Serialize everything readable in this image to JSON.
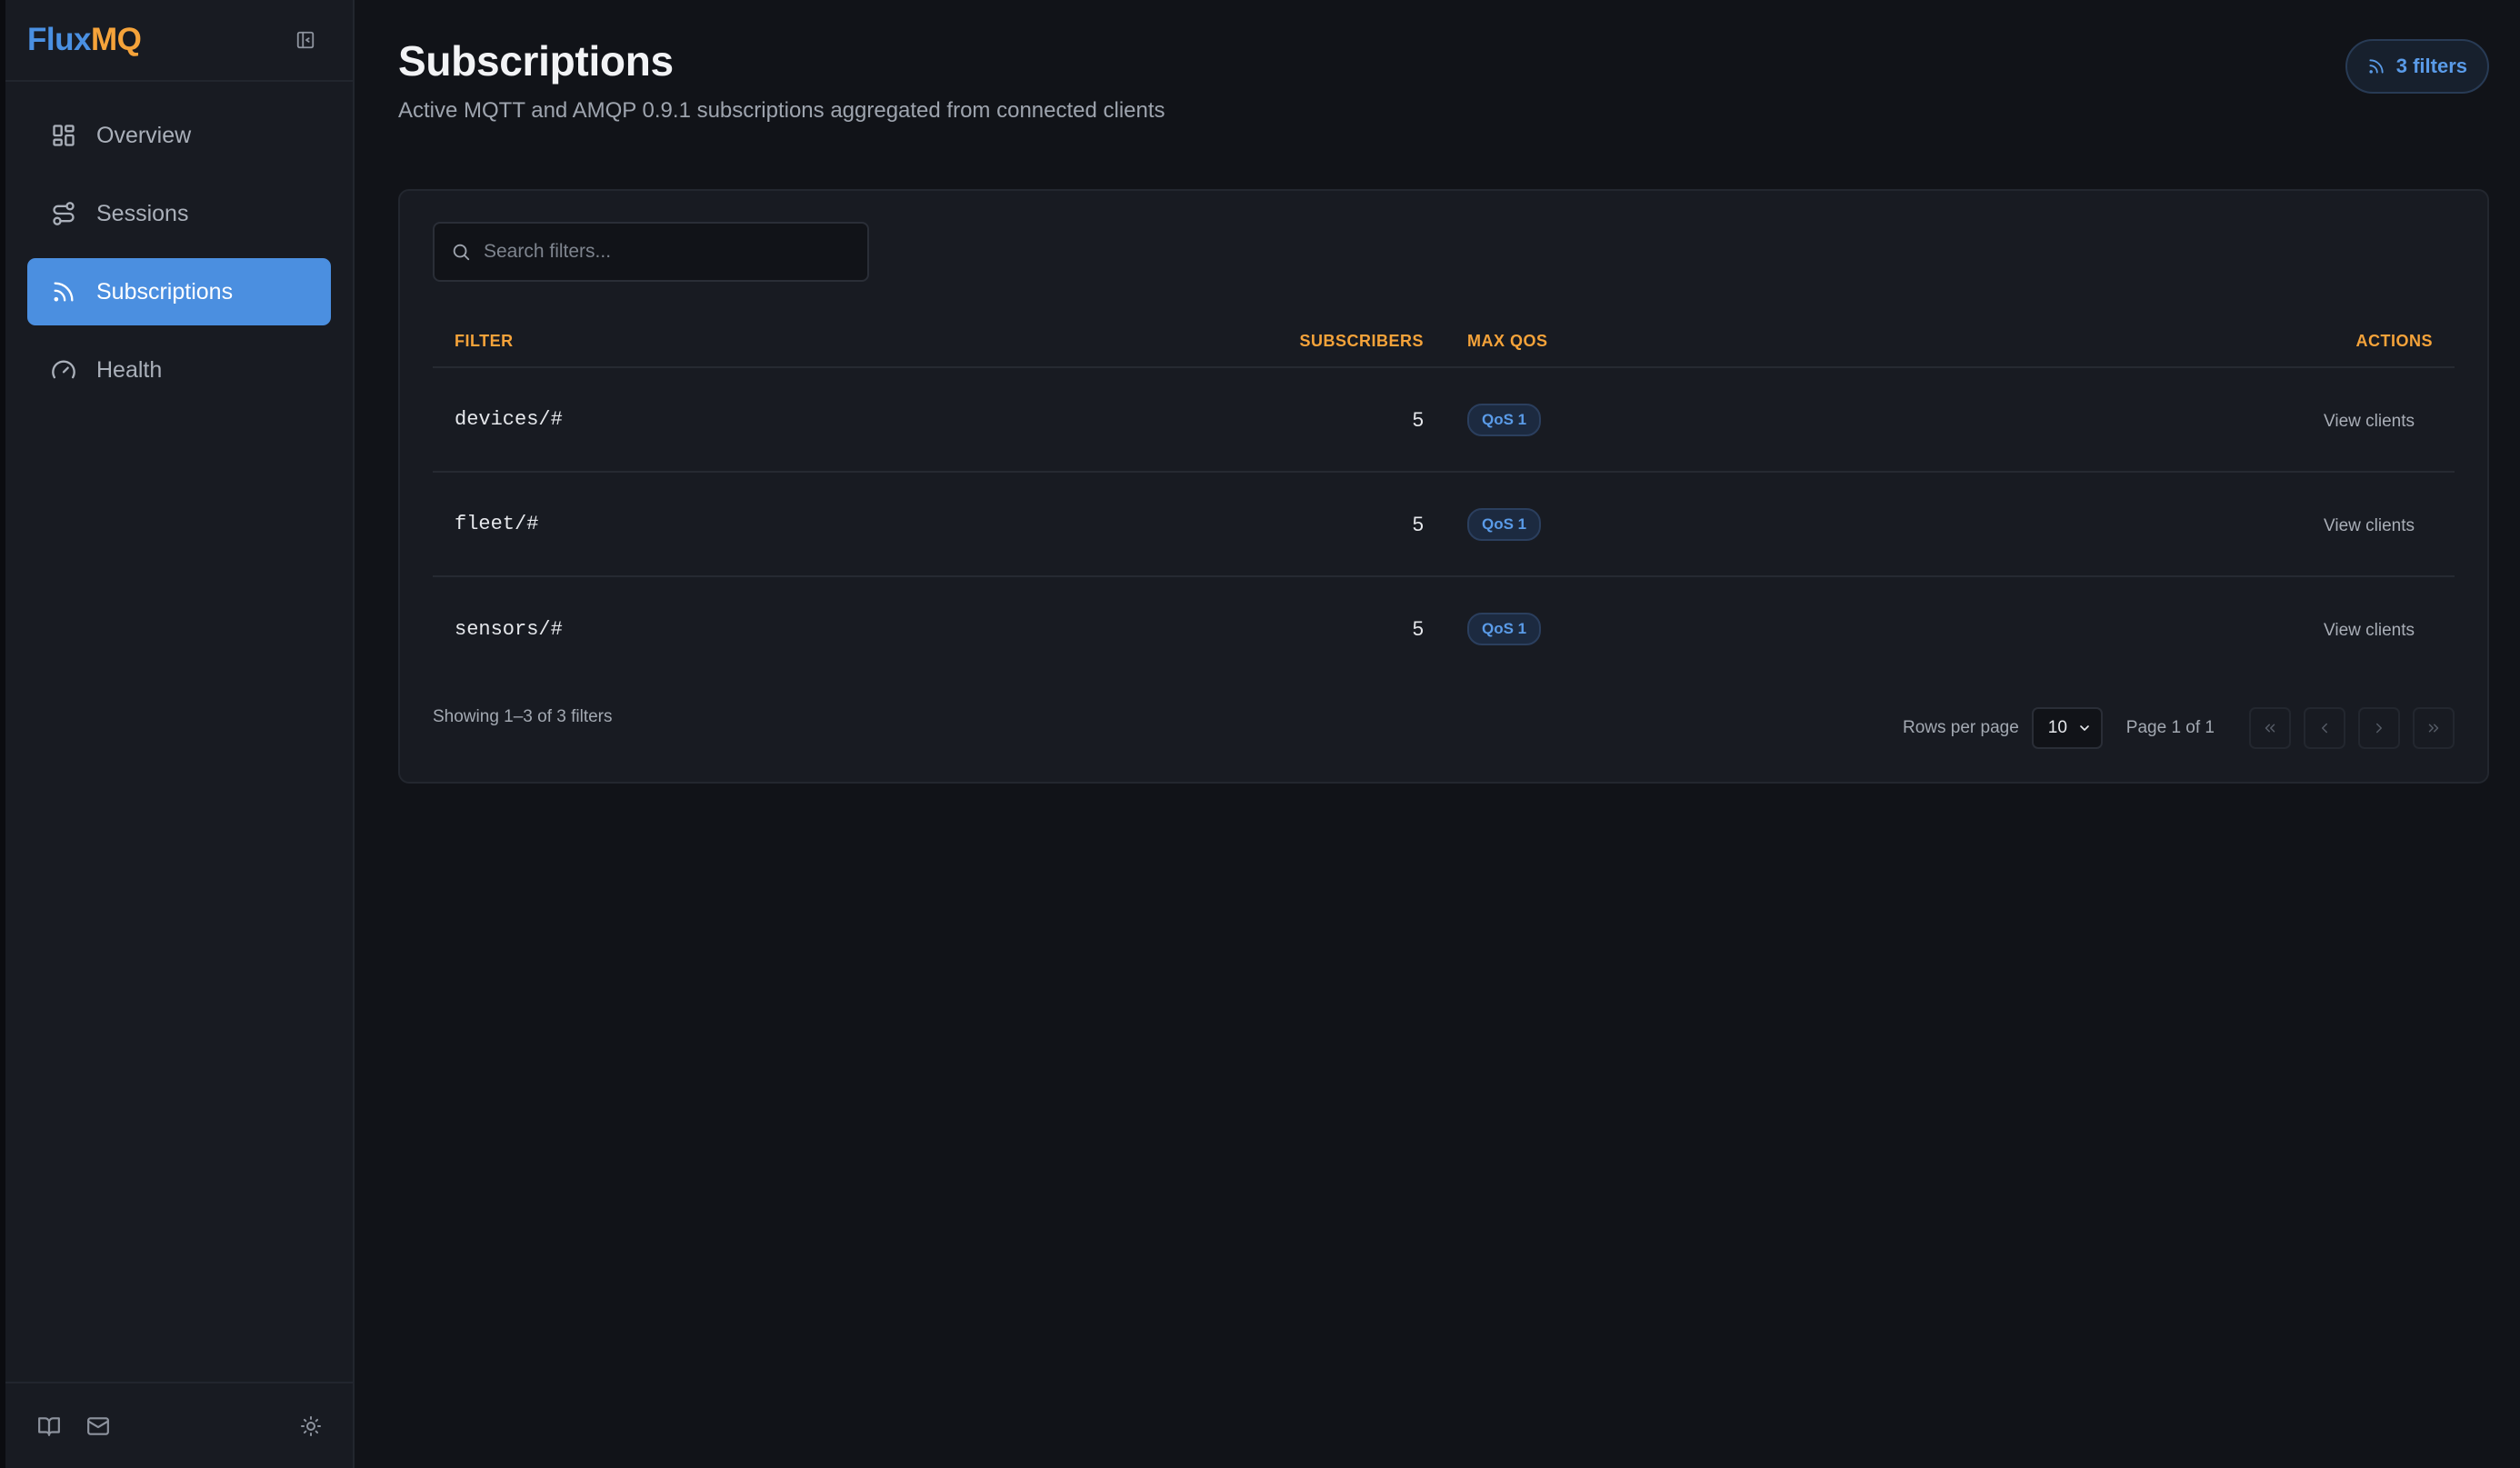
{
  "app": {
    "logo_part1": "Flux",
    "logo_part2": "MQ",
    "colors": {
      "accent": "#4b8fe0",
      "highlight": "#f5a33a",
      "background": "#111318"
    }
  },
  "sidebar": {
    "items": [
      {
        "label": "Overview",
        "icon": "layout-grid-icon",
        "active": false
      },
      {
        "label": "Sessions",
        "icon": "route-icon",
        "active": false
      },
      {
        "label": "Subscriptions",
        "icon": "rss-icon",
        "active": true
      },
      {
        "label": "Health",
        "icon": "gauge-icon",
        "active": false
      }
    ],
    "footer_icons": [
      "book-icon",
      "mail-icon",
      "sun-icon"
    ]
  },
  "header": {
    "title": "Subscriptions",
    "subtitle": "Active MQTT and AMQP 0.9.1 subscriptions aggregated from connected clients",
    "filters_badge": "3 filters"
  },
  "search": {
    "placeholder": "Search filters..."
  },
  "table": {
    "columns": {
      "filter": "Filter",
      "subscribers": "Subscribers",
      "max_qos": "Max QoS",
      "actions": "Actions"
    },
    "rows": [
      {
        "filter": "devices/#",
        "subscribers": "5",
        "qos": "QoS 1",
        "action": "View clients"
      },
      {
        "filter": "fleet/#",
        "subscribers": "5",
        "qos": "QoS 1",
        "action": "View clients"
      },
      {
        "filter": "sensors/#",
        "subscribers": "5",
        "qos": "QoS 1",
        "action": "View clients"
      }
    ]
  },
  "footer": {
    "showing": "Showing 1–3 of 3 filters",
    "rows_per_page_label": "Rows per page",
    "rows_per_page_value": "10",
    "page_info": "Page 1 of 1"
  }
}
